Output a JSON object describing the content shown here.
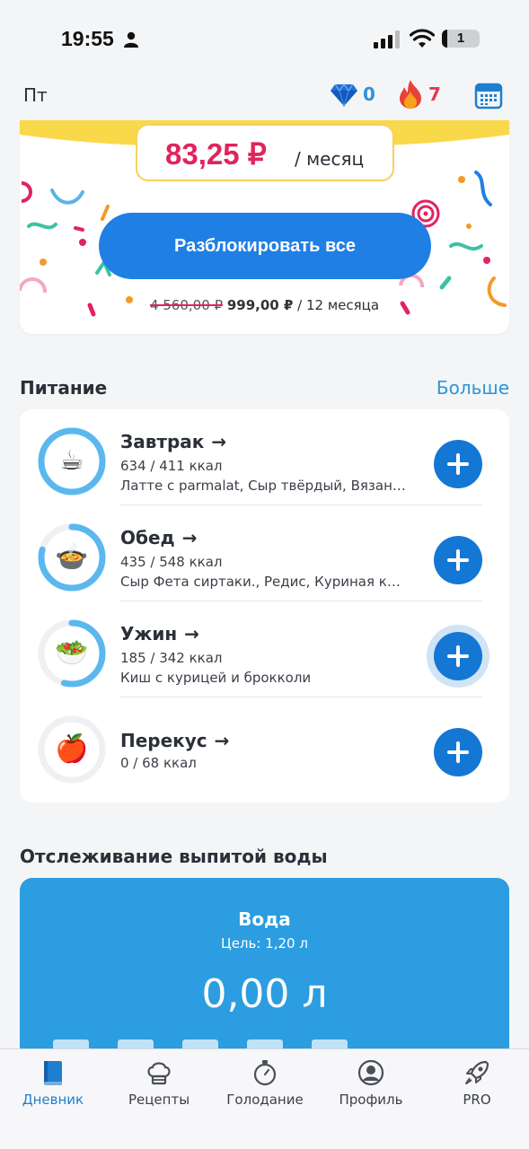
{
  "status_bar": {
    "time": "19:55",
    "battery": "1"
  },
  "top_bar": {
    "day": "Пт",
    "gems": "0",
    "streak": "7"
  },
  "promo": {
    "price": "83,25 ₽",
    "period": "/ месяц",
    "unlock_label": "Разблокировать все",
    "old_price": "4 560,00 ₽",
    "new_price": "999,00 ₽",
    "duration": "/ 12 месяца"
  },
  "nutrition": {
    "title": "Питание",
    "more_label": "Больше",
    "meals": [
      {
        "name": "Завтрак",
        "arrow": "→",
        "kcal": "634 / 411 ккал",
        "items": "Латте с parmalat, Сыр твёрдый, Вязанка…",
        "progress": 1.0,
        "icon": "coffee-icon"
      },
      {
        "name": "Обед",
        "arrow": "→",
        "kcal": "435 / 548 ккал",
        "items": "Сыр Фета сиртаки., Редис, Куриная кот…",
        "progress": 0.79,
        "icon": "soup-icon"
      },
      {
        "name": "Ужин",
        "arrow": "→",
        "kcal": "185 / 342 ккал",
        "items": "Киш с курицей и брокколи",
        "progress": 0.54,
        "icon": "salad-icon"
      },
      {
        "name": "Перекус",
        "arrow": "→",
        "kcal": "0 / 68 ккал",
        "items": "",
        "progress": 0.0,
        "icon": "apple-icon"
      }
    ]
  },
  "water": {
    "section_title": "Отслеживание выпитой воды",
    "title": "Вода",
    "goal": "Цель: 1,20 л",
    "amount": "0,00 л"
  },
  "nav": {
    "items": [
      {
        "label": "Дневник",
        "icon": "diary-icon",
        "active": true
      },
      {
        "label": "Рецепты",
        "icon": "chef-hat-icon",
        "active": false
      },
      {
        "label": "Голодание",
        "icon": "stopwatch-icon",
        "active": false
      },
      {
        "label": "Профиль",
        "icon": "profile-icon",
        "active": false
      },
      {
        "label": "PRO",
        "icon": "rocket-icon",
        "active": false
      }
    ]
  },
  "colors": {
    "accent": "#1f7fe4",
    "price": "#e0245e",
    "ring": "#5ab8ef",
    "water": "#2b9de0"
  }
}
